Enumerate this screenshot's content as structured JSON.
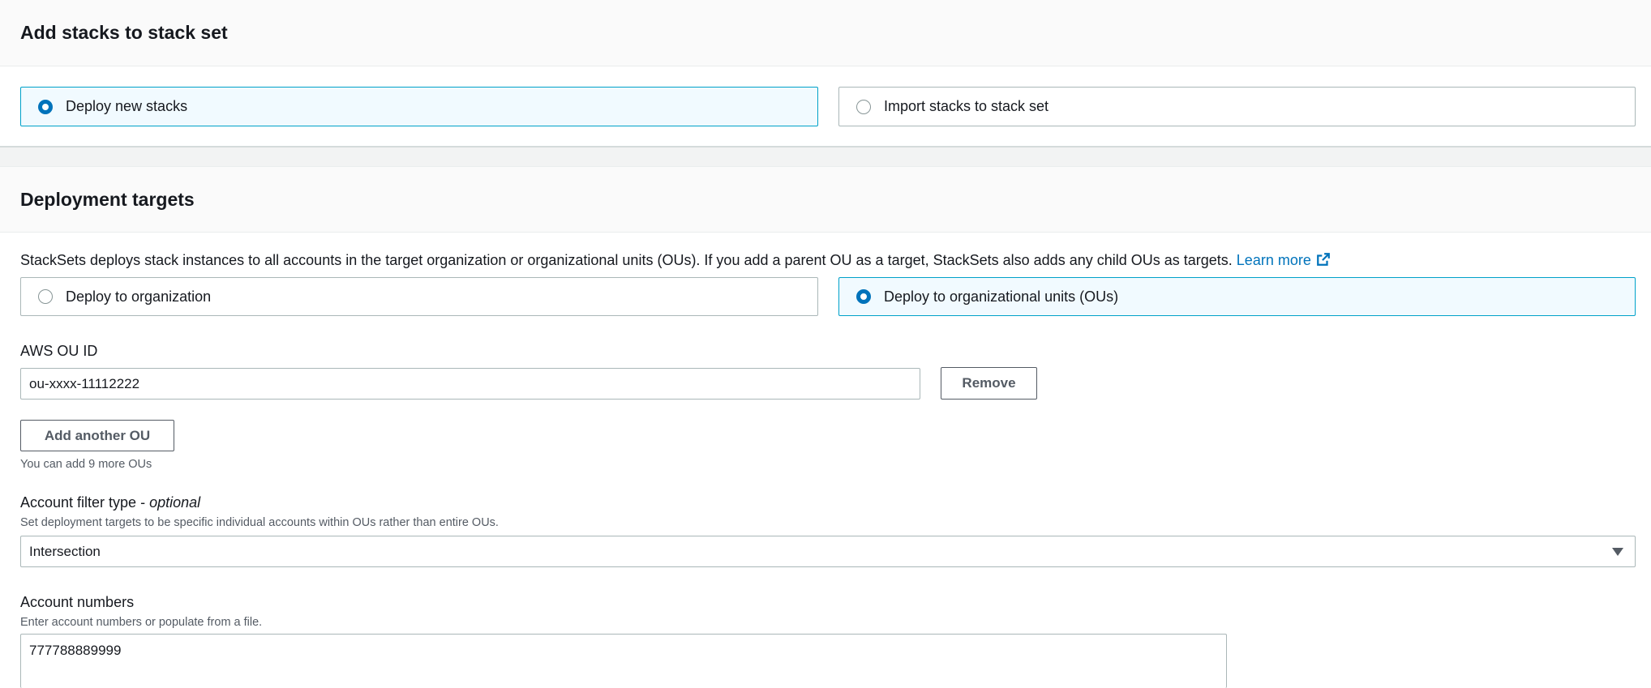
{
  "section_add": {
    "title": "Add stacks to stack set",
    "options": [
      {
        "label": "Deploy new stacks",
        "selected": true
      },
      {
        "label": "Import stacks to stack set",
        "selected": false
      }
    ]
  },
  "section_targets": {
    "title": "Deployment targets",
    "description": "StackSets deploys stack instances to all accounts in the target organization or organizational units (OUs). If you add a parent OU as a target, StackSets also adds any child OUs as targets.",
    "learn_more": "Learn more",
    "options": [
      {
        "label": "Deploy to organization",
        "selected": false
      },
      {
        "label": "Deploy to organizational units (OUs)",
        "selected": true
      }
    ],
    "ou_label": "AWS OU ID",
    "ou_value": "ou-xxxx-11112222",
    "remove_label": "Remove",
    "add_ou_label": "Add another OU",
    "add_ou_hint": "You can add 9 more OUs",
    "filter_label": "Account filter type - ",
    "filter_optional": "optional",
    "filter_hint": "Set deployment targets to be specific individual accounts within OUs rather than entire OUs.",
    "filter_value": "Intersection",
    "accounts_label": "Account numbers",
    "accounts_hint": "Enter account numbers or populate from a file.",
    "accounts_value": "777788889999"
  },
  "colors": {
    "accent": "#0073bb",
    "selected_border": "#00a1c9",
    "selected_bg": "#f1faff"
  }
}
